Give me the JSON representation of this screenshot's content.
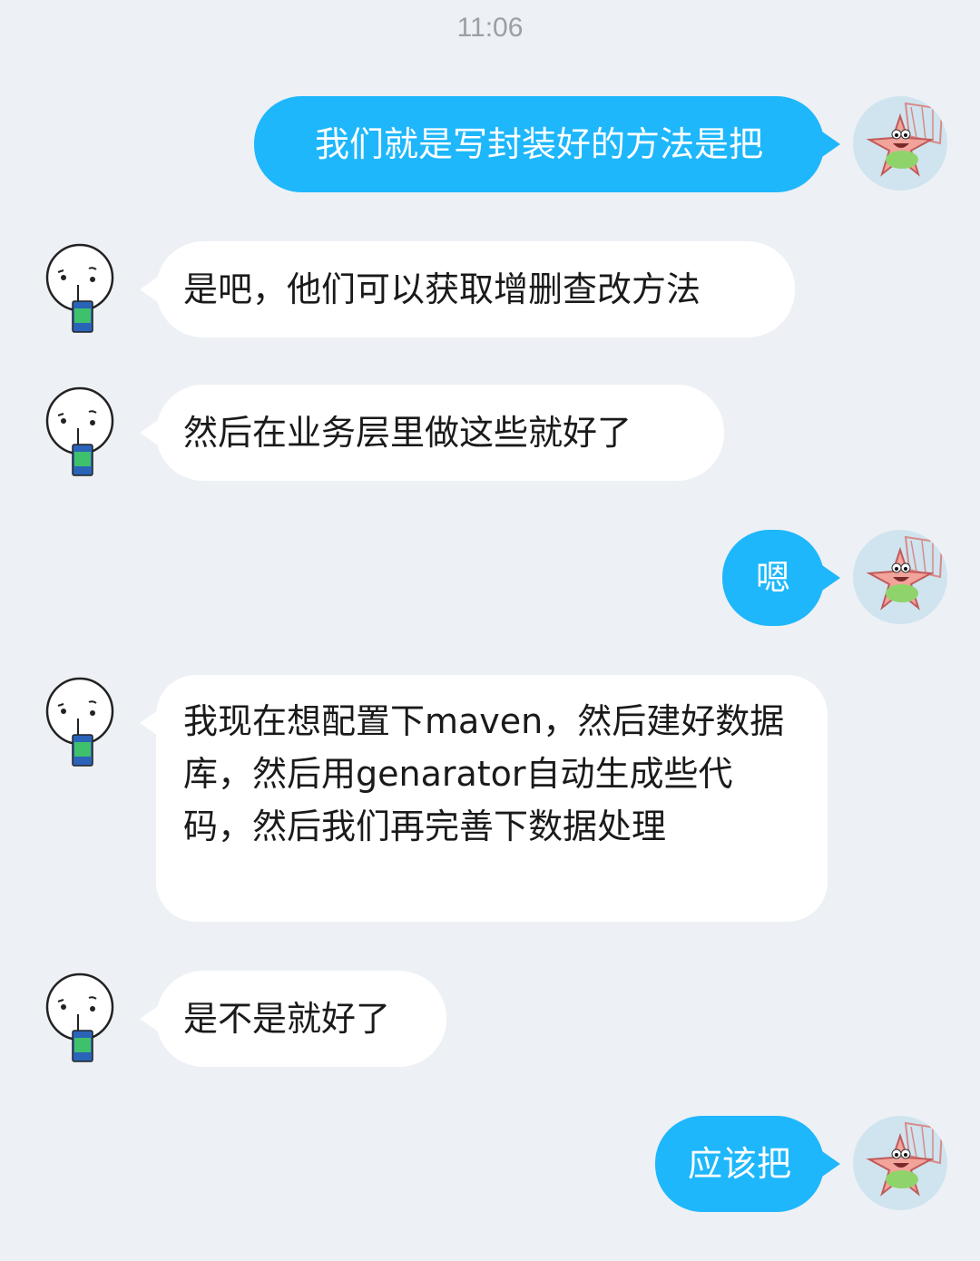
{
  "header": {
    "time": "11:06"
  },
  "avatars": {
    "sent": "patrick-star-avatar-icon",
    "received": "doodle-face-drink-avatar-icon"
  },
  "colors": {
    "background": "#edf0f5",
    "sent_bubble": "#1eb7fb",
    "received_bubble": "#ffffff",
    "timestamp": "#9a9ea6"
  },
  "messages": [
    {
      "side": "sent",
      "text": "我们就是写封装好的方法是把"
    },
    {
      "side": "received",
      "text": "是吧，他们可以获取增删查改方法"
    },
    {
      "side": "received",
      "text": "然后在业务层里做这些就好了"
    },
    {
      "side": "sent",
      "text": "嗯"
    },
    {
      "side": "received",
      "text": "我现在想配置下maven，然后建好数据库，然后用genarator自动生成些代码，然后我们再完善下数据处理"
    },
    {
      "side": "received",
      "text": "是不是就好了"
    },
    {
      "side": "sent",
      "text": "应该把"
    }
  ]
}
